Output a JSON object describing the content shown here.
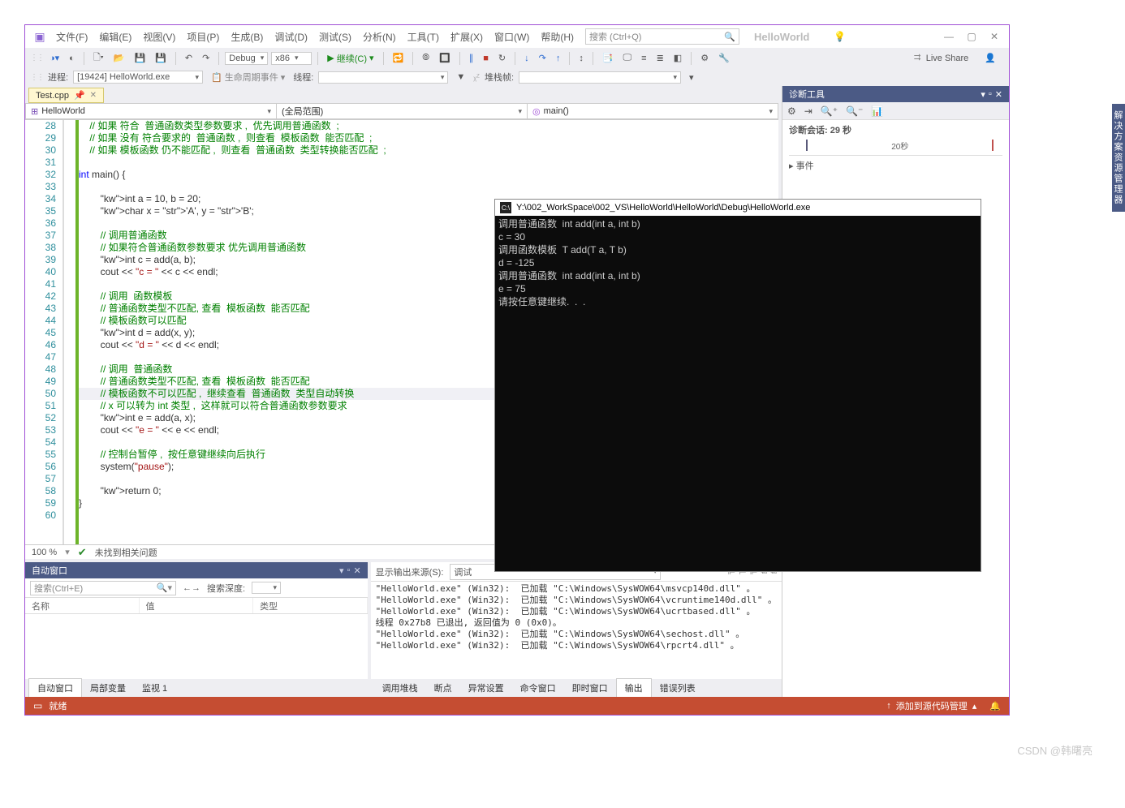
{
  "app": {
    "title": "HelloWorld"
  },
  "menu": [
    "文件(F)",
    "编辑(E)",
    "视图(V)",
    "项目(P)",
    "生成(B)",
    "调试(D)",
    "测试(S)",
    "分析(N)",
    "工具(T)",
    "扩展(X)",
    "窗口(W)",
    "帮助(H)"
  ],
  "search_placeholder": "搜索 (Ctrl+Q)",
  "toolbar": {
    "config": "Debug",
    "platform": "x86",
    "continue": "继续(C)",
    "liveshare": "Live Share"
  },
  "toolbar2": {
    "process_label": "进程:",
    "process_value": "[19424] HelloWorld.exe",
    "lifecycle": "生命周期事件",
    "thread_label": "线程:",
    "stackframe": "堆栈帧:"
  },
  "editor": {
    "tab": "Test.cpp",
    "ctx_scope": "HelloWorld",
    "ctx_global": "(全局范围)",
    "ctx_func": "main()",
    "zoom": "100 %",
    "issues": "未找到相关问题",
    "lines_start": 28,
    "lines_end": 60,
    "code": [
      {
        "t": "cmt",
        "s": "    // 如果 符合  普通函数类型参数要求 ,  优先调用普通函数  ;"
      },
      {
        "t": "cmt",
        "s": "    // 如果 没有 符合要求的  普通函数 ,  则查看  模板函数  能否匹配  ;"
      },
      {
        "t": "cmt",
        "s": "    // 如果 模板函数 仍不能匹配 ,  则查看  普通函数  类型转换能否匹配  ;"
      },
      {
        "t": "",
        "s": ""
      },
      {
        "t": "kw",
        "s": "int main() {"
      },
      {
        "t": "",
        "s": ""
      },
      {
        "t": "",
        "s": "        int a = 10, b = 20;"
      },
      {
        "t": "",
        "s": "        char x = 'A', y = 'B';"
      },
      {
        "t": "",
        "s": ""
      },
      {
        "t": "cmt",
        "s": "        // 调用普通函数"
      },
      {
        "t": "cmt",
        "s": "        // 如果符合普通函数参数要求 优先调用普通函数"
      },
      {
        "t": "",
        "s": "        int c = add(a, b);"
      },
      {
        "t": "",
        "s": "        cout << \"c = \" << c << endl;"
      },
      {
        "t": "",
        "s": ""
      },
      {
        "t": "cmt",
        "s": "        // 调用  函数模板"
      },
      {
        "t": "cmt",
        "s": "        // 普通函数类型不匹配, 查看  模板函数  能否匹配"
      },
      {
        "t": "cmt",
        "s": "        // 模板函数可以匹配"
      },
      {
        "t": "",
        "s": "        int d = add(x, y);"
      },
      {
        "t": "",
        "s": "        cout << \"d = \" << d << endl;"
      },
      {
        "t": "",
        "s": ""
      },
      {
        "t": "cmt",
        "s": "        // 调用  普通函数"
      },
      {
        "t": "cmt",
        "s": "        // 普通函数类型不匹配, 查看  模板函数  能否匹配"
      },
      {
        "t": "cmt",
        "s": "        // 模板函数不可以匹配 ,  继续查看  普通函数  类型自动转换",
        "hl": true
      },
      {
        "t": "cmt",
        "s": "        // x 可以转为 int 类型 ,  这样就可以符合普通函数参数要求"
      },
      {
        "t": "",
        "s": "        int e = add(a, x);"
      },
      {
        "t": "",
        "s": "        cout << \"e = \" << e << endl;"
      },
      {
        "t": "",
        "s": ""
      },
      {
        "t": "cmt",
        "s": "        // 控制台暂停 ,  按任意键继续向后执行"
      },
      {
        "t": "",
        "s": "        system(\"pause\");"
      },
      {
        "t": "",
        "s": ""
      },
      {
        "t": "",
        "s": "        return 0;"
      },
      {
        "t": "",
        "s": "}"
      },
      {
        "t": "",
        "s": ""
      }
    ]
  },
  "autos": {
    "title": "自动窗口",
    "search_placeholder": "搜索(Ctrl+E)",
    "depth_label": "搜索深度:",
    "cols": [
      "名称",
      "值",
      "类型"
    ],
    "tabs": [
      "自动窗口",
      "局部变量",
      "监视 1"
    ]
  },
  "output": {
    "src_label": "显示输出来源(S):",
    "src_value": "调试",
    "lines": [
      "\"HelloWorld.exe\" (Win32):  已加载 \"C:\\Windows\\SysWOW64\\msvcp140d.dll\" 。",
      "\"HelloWorld.exe\" (Win32):  已加载 \"C:\\Windows\\SysWOW64\\vcruntime140d.dll\" 。",
      "\"HelloWorld.exe\" (Win32):  已加载 \"C:\\Windows\\SysWOW64\\ucrtbased.dll\" 。",
      "线程 0x27b8 已退出, 返回值为 0 (0x0)。",
      "\"HelloWorld.exe\" (Win32):  已加载 \"C:\\Windows\\SysWOW64\\sechost.dll\" 。",
      "\"HelloWorld.exe\" (Win32):  已加载 \"C:\\Windows\\SysWOW64\\rpcrt4.dll\" 。"
    ],
    "tabs": [
      "调用堆栈",
      "断点",
      "异常设置",
      "命令窗口",
      "即时窗口",
      "输出",
      "错误列表"
    ]
  },
  "diag": {
    "title": "诊断工具",
    "session": "诊断会话: 29 秒",
    "tick_label": "20秒",
    "events": "事件"
  },
  "right_tab": "解决方案资源管理器",
  "console": {
    "title": "Y:\\002_WorkSpace\\002_VS\\HelloWorld\\HelloWorld\\Debug\\HelloWorld.exe",
    "lines": [
      "调用普通函数  int add(int a, int b)",
      "c = 30",
      "调用函数模板  T add(T a, T b)",
      "d = -125",
      "调用普通函数  int add(int a, int b)",
      "e = 75",
      "请按任意键继续.  .  ."
    ]
  },
  "status": {
    "text": "就绪",
    "source_ctrl": "添加到源代码管理"
  },
  "watermark": "CSDN @韩曙亮"
}
